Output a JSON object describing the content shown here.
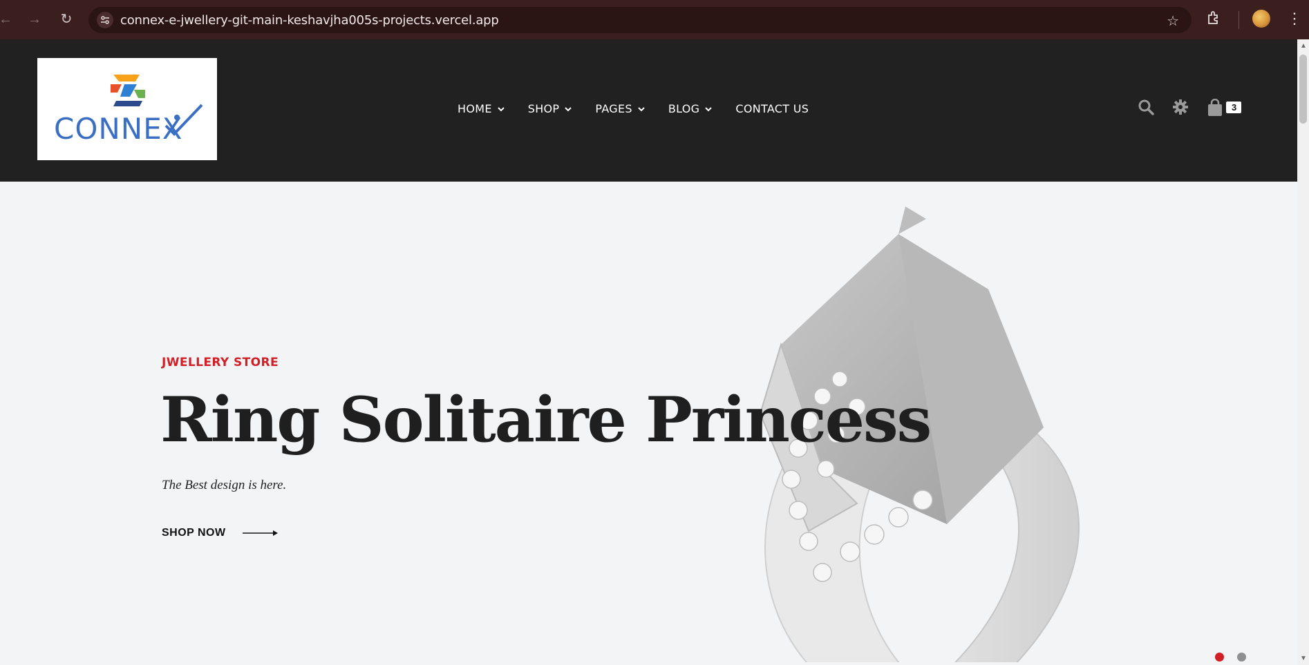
{
  "browser": {
    "url": "connex-e-jwellery-git-main-keshavjha005s-projects.vercel.app"
  },
  "header": {
    "logo_text": "CONNEX",
    "nav": [
      {
        "label": "HOME",
        "has_dropdown": true
      },
      {
        "label": "SHOP",
        "has_dropdown": true
      },
      {
        "label": "PAGES",
        "has_dropdown": true
      },
      {
        "label": "BLOG",
        "has_dropdown": true
      },
      {
        "label": "CONTACT US",
        "has_dropdown": false
      }
    ],
    "cart_count": "3",
    "icons": [
      "search-icon",
      "gear-icon",
      "shopping-bag-icon"
    ]
  },
  "hero": {
    "eyebrow": "JWELLERY STORE",
    "title": "Ring Solitaire Princess",
    "subtitle": "The Best design is here.",
    "cta_label": "SHOP NOW",
    "slides": 2,
    "active_slide": 1
  },
  "colors": {
    "header_bg": "#212121",
    "accent": "#d21f26",
    "page_bg": "#f3f4f6",
    "browser_chrome": "#3b1f1f"
  }
}
